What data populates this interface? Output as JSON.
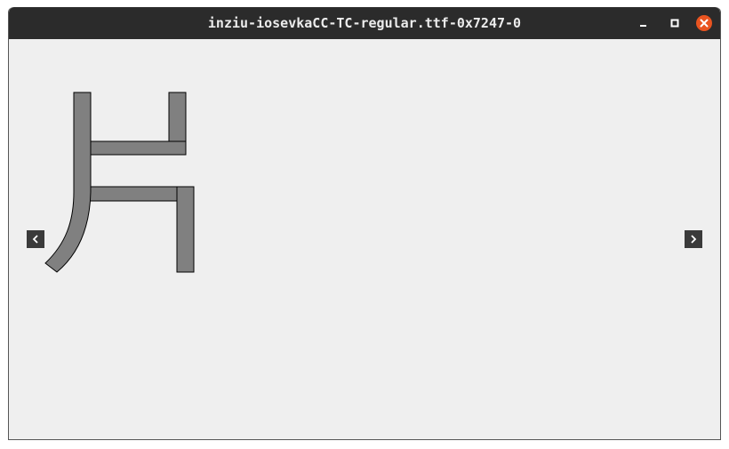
{
  "window": {
    "title": "inziu-iosevkaCC-TC-regular.ttf-0x7247-0"
  },
  "controls": {
    "minimize_icon": "minimize-icon",
    "maximize_icon": "maximize-icon",
    "close_icon": "close-icon",
    "close_color": "#e95420"
  },
  "viewer": {
    "glyph_char": "片",
    "glyph_fill": "#808080",
    "prev_icon": "chevron-left-icon",
    "next_icon": "chevron-right-icon"
  }
}
